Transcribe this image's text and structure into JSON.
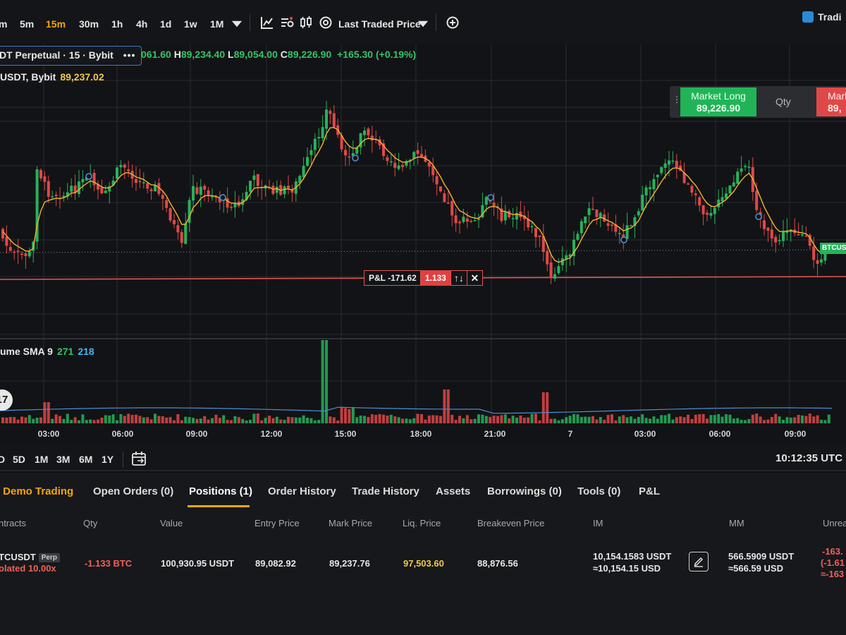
{
  "toolbar": {
    "intervals": [
      "m",
      "5m",
      "15m",
      "30m",
      "1h",
      "4h",
      "1d",
      "1w",
      "1M"
    ],
    "active_interval": "15m",
    "price_type": "Last Traded Price",
    "trading_button": "Tradi",
    "icons": [
      "chevron-down-icon",
      "chart-type-icon",
      "indicators-icon",
      "candles-icon",
      "settings-icon",
      "add-icon"
    ]
  },
  "chart": {
    "symbol_label": "DT Perpetual · 15 · Bybit",
    "ohlc": {
      "open": "061.60",
      "high_label": "H",
      "high": "89,234.40",
      "low_label": "L",
      "low": "89,054.00",
      "close_label": "C",
      "close": "89,226.90",
      "change": "+165.30 (+0.19%)"
    },
    "sub_symbol": "USDT, Bybit",
    "sub_price": "89,237.02",
    "volume_label": "ume SMA 9",
    "volume_value_1": "271",
    "volume_value_2": "218",
    "market_long_label": "Market Long",
    "market_long_price": "89,226.90",
    "qty_label": "Qty",
    "market_short_label": "Mark",
    "market_short_price": "89,",
    "pnl_label": "P&L -171.62",
    "pnl_qty": "1.133",
    "reverse_icon": "↑↓",
    "close_icon": "✕",
    "price_tag": "BTCUS",
    "logo_text": "17",
    "colors": {
      "up": "#26b35a",
      "down": "#e04848",
      "ma": "#f2b230",
      "position_line": "#e25454",
      "volume_sma": "#4a8fd6"
    },
    "time_ticks": [
      "03:00",
      "06:00",
      "09:00",
      "12:00",
      "15:00",
      "18:00",
      "21:00",
      "7",
      "03:00",
      "06:00",
      "09:00"
    ]
  },
  "range_bar": {
    "ranges": [
      "D",
      "5D",
      "1M",
      "3M",
      "6M",
      "1Y"
    ],
    "time": "10:12:35 UTC"
  },
  "positions": {
    "tabs": [
      "Demo Trading",
      "Open Orders (0)",
      "Positions (1)",
      "Order History",
      "Trade History",
      "Assets",
      "Borrowings (0)",
      "Tools (0)",
      "P&L"
    ],
    "active_tab": "Positions (1)",
    "columns": [
      "ntracts",
      "Qty",
      "Value",
      "Entry Price",
      "Mark Price",
      "Liq. Price",
      "Breakeven Price",
      "IM",
      "MM",
      "Unrea"
    ],
    "row": {
      "contract": "TCUSDT",
      "badge": "Perp",
      "margin_mode": "olated 10.00x",
      "qty": "-1.133 BTC",
      "value": "100,930.95 USDT",
      "entry_price": "89,082.92",
      "mark_price": "89,237.76",
      "liq_price": "97,503.60",
      "breakeven_price": "88,876.56",
      "im_usdt": "10,154.1583 USDT",
      "im_usd": "≈10,154.15 USD",
      "mm_usdt": "566.5909 USDT",
      "mm_usd": "≈566.59 USD",
      "unrealized_1": "-163.",
      "unrealized_2": "(-1.61",
      "unrealized_3": "≈-163"
    }
  }
}
